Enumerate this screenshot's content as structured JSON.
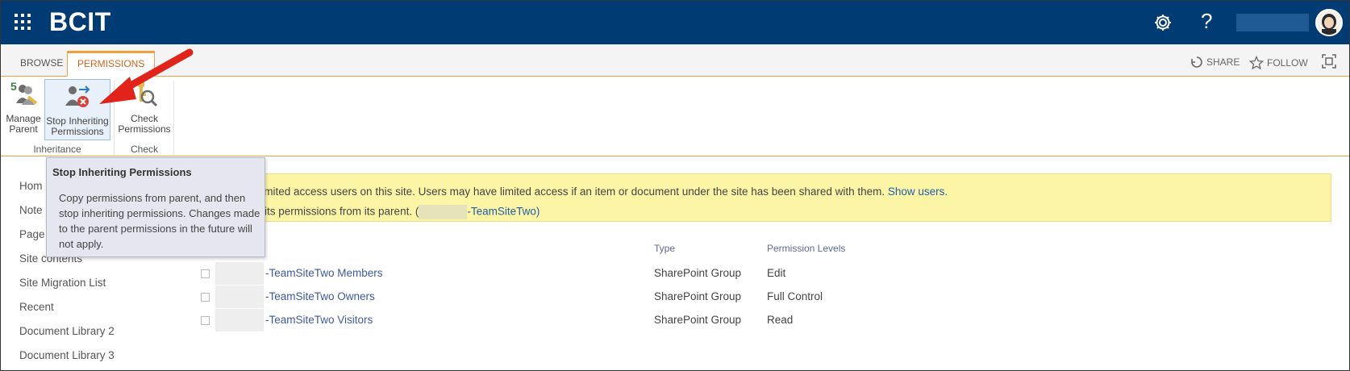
{
  "suitebar": {
    "brand": "BCIT",
    "help_label": "?",
    "icons": [
      "waffle-icon",
      "gear-icon",
      "avatar"
    ],
    "color": "#003b73"
  },
  "ribbon_tabs": {
    "browse": "BROWSE",
    "permissions": "PERMISSIONS",
    "share": "SHARE",
    "follow": "FOLLOW",
    "accent": "#f2a13a"
  },
  "ribbon": {
    "manage_parent": [
      "Manage",
      "Parent"
    ],
    "stop_inheriting": [
      "Stop Inheriting",
      "Permissions"
    ],
    "check_permissions": [
      "Check",
      "Permissions"
    ],
    "group_inheritance": "Inheritance",
    "group_check": "Check"
  },
  "tooltip": {
    "title": "Stop Inheriting Permissions",
    "body": "Copy permissions from parent, and then stop inheriting permissions. Changes made to the parent permissions in the future will not apply."
  },
  "leftnav": {
    "items": [
      "Hom",
      "Note",
      "Page",
      "Site contents",
      "Site Migration List",
      "Recent",
      "Document Library 2",
      "Document Library 3"
    ]
  },
  "notice": {
    "line1_text": "are limited access users on this site. Users may have limited access if an item or document under the site has been shared with them.",
    "line1_link": "Show users.",
    "line2_prefix": "inherits permissions from its parent. (",
    "line2_link": "-TeamSiteTwo)",
    "color": "#fdf5a6"
  },
  "table": {
    "headers": {
      "type": "Type",
      "levels": "Permission Levels"
    },
    "rows": [
      {
        "name": "-TeamSiteTwo Members",
        "type": "SharePoint Group",
        "level": "Edit"
      },
      {
        "name": "-TeamSiteTwo Owners",
        "type": "SharePoint Group",
        "level": "Full Control"
      },
      {
        "name": "-TeamSiteTwo Visitors",
        "type": "SharePoint Group",
        "level": "Read"
      }
    ]
  }
}
